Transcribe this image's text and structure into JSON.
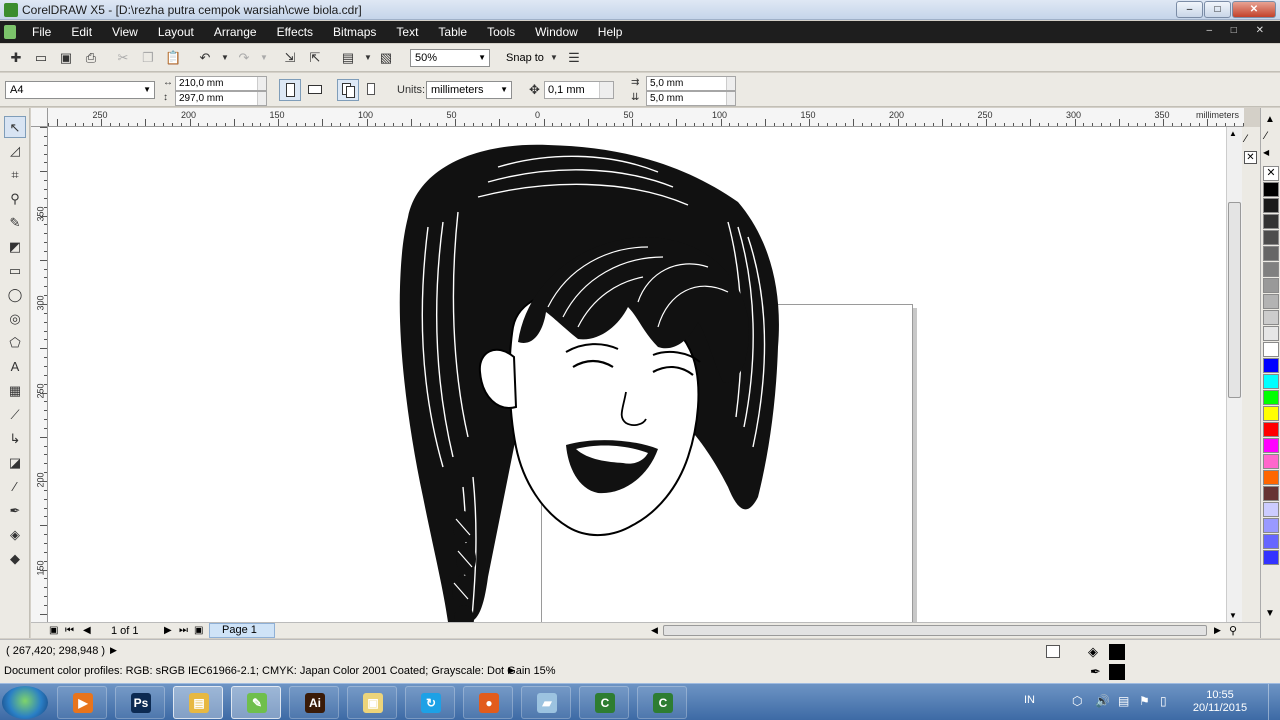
{
  "window": {
    "title": "CorelDRAW X5 - [D:\\rezha putra cempok warsiah\\cwe biola.cdr]",
    "controls": {
      "minimize": "–",
      "maximize": "□",
      "close": "✕"
    }
  },
  "menu": {
    "items": [
      "File",
      "Edit",
      "View",
      "Layout",
      "Arrange",
      "Effects",
      "Bitmaps",
      "Text",
      "Table",
      "Tools",
      "Window",
      "Help"
    ],
    "mdi_controls": "– □ ✕"
  },
  "standard_toolbar": {
    "zoom": "50%",
    "snap_to": "Snap to"
  },
  "property_bar": {
    "paper_size": "A4",
    "width": "210,0 mm",
    "height": "297,0 mm",
    "units_label": "Units:",
    "units_value": "millimeters",
    "nudge": "0,1 mm",
    "dup_x": "5,0 mm",
    "dup_y": "5,0 mm"
  },
  "rulers": {
    "unit_label": "millimeters",
    "h_ticks": [
      "250",
      "200",
      "150",
      "100",
      "50",
      "0",
      "50",
      "100",
      "150",
      "200",
      "250",
      "300",
      "350"
    ],
    "v_ticks": [
      "350",
      "300",
      "250",
      "200",
      "150"
    ]
  },
  "palette": {
    "colors": [
      "#000000",
      "#1a1a1a",
      "#333333",
      "#4d4d4d",
      "#666666",
      "#808080",
      "#999999",
      "#b3b3b3",
      "#cccccc",
      "#e6e6e6",
      "#ffffff",
      "#0000ff",
      "#00ffff",
      "#00ff00",
      "#ffff00",
      "#ff0000",
      "#ff00ff",
      "#ff66cc",
      "#ff6600",
      "#663333",
      "#ccccff",
      "#9999ff",
      "#6666ff",
      "#3333ff"
    ]
  },
  "page_navigator": {
    "page_count": "1 of 1",
    "tab_label": "Page 1"
  },
  "status": {
    "coordinates": "( 267,420; 298,948 )",
    "color_profiles": "Document color profiles: RGB: sRGB IEC61966-2.1; CMYK: Japan Color 2001 Coated; Grayscale: Dot Gain 15%"
  },
  "taskbar": {
    "apps": [
      {
        "name": "media-player",
        "glyph": "▶",
        "color": "#e8741c"
      },
      {
        "name": "photoshop",
        "glyph": "Ps",
        "color": "#0c2a52"
      },
      {
        "name": "file-explorer",
        "glyph": "▤",
        "color": "#e7b842"
      },
      {
        "name": "coreldraw",
        "glyph": "✎",
        "color": "#6fbf4c"
      },
      {
        "name": "illustrator",
        "glyph": "Ai",
        "color": "#3a1b08"
      },
      {
        "name": "folder",
        "glyph": "▣",
        "color": "#ecd47a"
      },
      {
        "name": "sync",
        "glyph": "↻",
        "color": "#1da1e6"
      },
      {
        "name": "firefox",
        "glyph": "●",
        "color": "#e25c1c"
      },
      {
        "name": "notes",
        "glyph": "▰",
        "color": "#9cc3e0"
      },
      {
        "name": "camtasia-1",
        "glyph": "C",
        "color": "#2e7d32"
      },
      {
        "name": "camtasia-2",
        "glyph": "C",
        "color": "#2e7d32"
      }
    ],
    "language": "IN",
    "time": "10:55",
    "date": "20/11/2015"
  }
}
